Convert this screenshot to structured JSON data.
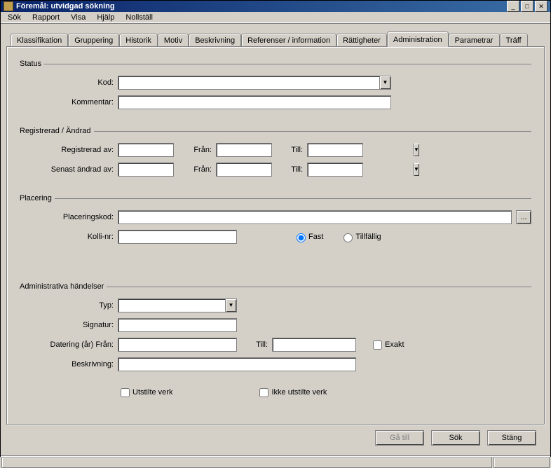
{
  "window": {
    "title": "Föremål: utvidgad sökning",
    "controls": {
      "min": "_",
      "max": "□",
      "close": "✕"
    }
  },
  "menu": {
    "sok": "Sök",
    "rapport": "Rapport",
    "visa": "Visa",
    "hjalp": "Hjälp",
    "nollstall": "Nollställ"
  },
  "tabs": {
    "klassifikation": "Klassifikation",
    "gruppering": "Gruppering",
    "historik": "Historik",
    "motiv": "Motiv",
    "beskrivning": "Beskrivning",
    "referenser": "Referenser / information",
    "rattigheter": "Rättigheter",
    "administration": "Administration",
    "parametrar": "Parametrar",
    "traff": "Träff"
  },
  "groups": {
    "status": "Status",
    "registrerad": "Registrerad / Ändrad",
    "placering": "Placering",
    "handelser": "Administrativa händelser"
  },
  "labels": {
    "kod": "Kod:",
    "kommentar": "Kommentar:",
    "registrerad_av": "Registrerad av:",
    "senast_andrad_av": "Senast ändrad av:",
    "fran": "Från:",
    "till": "Till:",
    "placeringskod": "Placeringskod:",
    "kolli_nr": "Kolli-nr:",
    "fast": "Fast",
    "tillfallig": "Tillfällig",
    "typ": "Typ:",
    "signatur": "Signatur:",
    "datering_fran": "Datering (år) Från:",
    "beskrivning": "Beskrivning:",
    "exakt": "Exakt",
    "utstilte_verk": "Utstilte verk",
    "ikke_utstilte_verk": "Ikke utstilte verk",
    "browse": "..."
  },
  "values": {
    "kod": "",
    "kommentar": "",
    "registrerad_av": "",
    "reg_fran": "",
    "reg_till": "",
    "senast_andrad_av": "",
    "andrad_fran": "",
    "andrad_till": "",
    "placeringskod": "",
    "kolli_nr": "",
    "placering_radio": "fast",
    "typ": "",
    "signatur": "",
    "datering_fran": "",
    "datering_till": "",
    "beskrivning": "",
    "exakt": false,
    "utstilte_verk": false,
    "ikke_utstilte_verk": false
  },
  "buttons": {
    "ga_till": "Gå till",
    "sok": "Sök",
    "stang": "Stäng"
  }
}
